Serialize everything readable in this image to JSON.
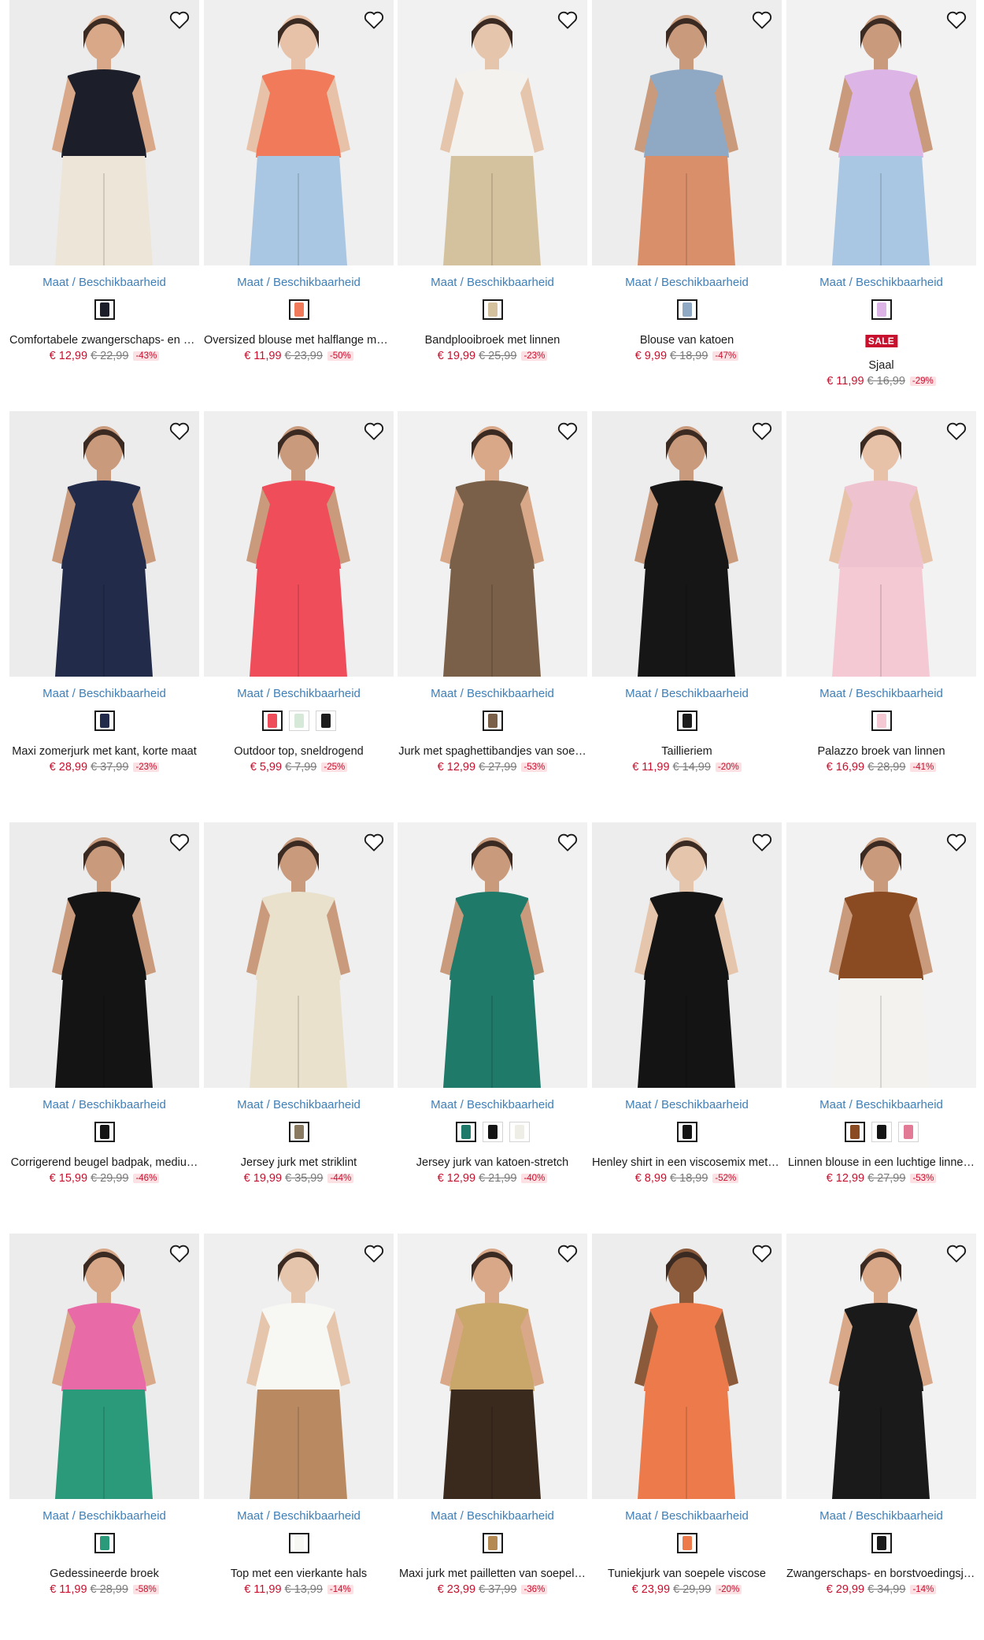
{
  "size_link_label": "Maat / Beschikbaarheid",
  "colors": {
    "accent_price": "#c8102e",
    "link": "#3f7fb8",
    "sale_badge": "#c8102e",
    "discount_bg": "#fbe1e4"
  },
  "products": [
    {
      "title": "Comfortabele zwangerschaps- en b…",
      "price": "€ 12,99",
      "old": "€ 22,99",
      "discount": "-43%",
      "sale": "",
      "bg": "#ececec",
      "swatches": [
        "#1c1f2a"
      ],
      "top": "#1c1f2a",
      "bottom": "#ece5d8",
      "skin": "#d8a888"
    },
    {
      "title": "Oversized blouse met halflange mo…",
      "price": "€ 11,99",
      "old": "€ 23,99",
      "discount": "-50%",
      "sale": "",
      "bg": "#efefef",
      "swatches": [
        "#f07a5a"
      ],
      "top": "#f07a5a",
      "bottom": "#a9c6e2",
      "skin": "#e8c2a8"
    },
    {
      "title": "Bandplooibroek met linnen",
      "price": "€ 19,99",
      "old": "€ 25,99",
      "discount": "-23%",
      "sale": "",
      "bg": "#f1f1f1",
      "swatches": [
        "#d4c29e"
      ],
      "top": "#f4f2ee",
      "bottom": "#d4c29e",
      "skin": "#e5c6ad"
    },
    {
      "title": "Blouse van katoen",
      "price": "€ 9,99",
      "old": "€ 18,99",
      "discount": "-47%",
      "sale": "",
      "bg": "#ededed",
      "swatches": [
        "#8fa8c4"
      ],
      "top": "#8fa8c4",
      "bottom": "#d98f6a",
      "skin": "#c99a7c"
    },
    {
      "title": "Sjaal",
      "price": "€ 11,99",
      "old": "€ 16,99",
      "discount": "-29%",
      "sale": "SALE",
      "bg": "#f2f2f2",
      "swatches": [
        "#dcb4e6"
      ],
      "top": "#dcb4e6",
      "bottom": "#a9c6e2",
      "skin": "#c99a7c"
    },
    {
      "title": "Maxi zomerjurk met kant, korte maat",
      "price": "€ 28,99",
      "old": "€ 37,99",
      "discount": "-23%",
      "sale": "",
      "bg": "#ececec",
      "swatches": [
        "#222b4a"
      ],
      "top": "#222b4a",
      "bottom": "#222b4a",
      "skin": "#c99a7c"
    },
    {
      "title": "Outdoor top, sneldrogend",
      "price": "€ 5,99",
      "old": "€ 7,99",
      "discount": "-25%",
      "sale": "",
      "bg": "#efefef",
      "swatches": [
        "#ef4d5a",
        "#d6e8d8",
        "#1c1c1c"
      ],
      "top": "#ef4d5a",
      "bottom": "#ef4d5a",
      "skin": "#c99a7c"
    },
    {
      "title": "Jurk met spaghettibandjes van soe…",
      "price": "€ 12,99",
      "old": "€ 27,99",
      "discount": "-53%",
      "sale": "",
      "bg": "#f1f1f1",
      "swatches": [
        "#7a6048"
      ],
      "top": "#7a6048",
      "bottom": "#7a6048",
      "skin": "#d8a888"
    },
    {
      "title": "Taillieriem",
      "price": "€ 11,99",
      "old": "€ 14,99",
      "discount": "-20%",
      "sale": "",
      "bg": "#ededed",
      "swatches": [
        "#1c1c1c"
      ],
      "top": "#161616",
      "bottom": "#161616",
      "skin": "#c99a7c"
    },
    {
      "title": "Palazzo broek van linnen",
      "price": "€ 16,99",
      "old": "€ 28,99",
      "discount": "-41%",
      "sale": "",
      "bg": "#f2f2f2",
      "swatches": [
        "#f4c9d4"
      ],
      "top": "#eec2cf",
      "bottom": "#f4c9d4",
      "skin": "#e8c2a8"
    },
    {
      "title": "Corrigerend beugel badpak, mediu…",
      "price": "€ 15,99",
      "old": "€ 29,99",
      "discount": "-46%",
      "sale": "",
      "bg": "#ececec",
      "swatches": [
        "#141414"
      ],
      "top": "#141414",
      "bottom": "#141414",
      "skin": "#c99a7c"
    },
    {
      "title": "Jersey jurk met striklint",
      "price": "€ 19,99",
      "old": "€ 35,99",
      "discount": "-44%",
      "sale": "",
      "bg": "#efefef",
      "swatches": [
        "#8a7a62"
      ],
      "top": "#e9e1cc",
      "bottom": "#e9e1cc",
      "skin": "#c99a7c"
    },
    {
      "title": "Jersey jurk van katoen-stretch",
      "price": "€ 12,99",
      "old": "€ 21,99",
      "discount": "-40%",
      "sale": "",
      "bg": "#f1f1f1",
      "swatches": [
        "#1f7a6a",
        "#141414",
        "#efeee6"
      ],
      "top": "#1f7a6a",
      "bottom": "#1f7a6a",
      "skin": "#c99a7c"
    },
    {
      "title": "Henley shirt in een viscosemix met …",
      "price": "€ 8,99",
      "old": "€ 18,99",
      "discount": "-52%",
      "sale": "",
      "bg": "#ededed",
      "swatches": [
        "#141414"
      ],
      "top": "#141414",
      "bottom": "#141414",
      "skin": "#e5c6ad"
    },
    {
      "title": "Linnen blouse in een luchtige linne…",
      "price": "€ 12,99",
      "old": "€ 27,99",
      "discount": "-53%",
      "sale": "",
      "bg": "#f2f2f2",
      "swatches": [
        "#8a4a22",
        "#141414",
        "#e27a96"
      ],
      "top": "#8a4a22",
      "bottom": "#f4f2ee",
      "skin": "#c99a7c"
    },
    {
      "title": "Gedessineerde broek",
      "price": "€ 11,99",
      "old": "€ 28,99",
      "discount": "-58%",
      "sale": "",
      "bg": "#ececec",
      "swatches": [
        "#2a9a7a"
      ],
      "top": "#e86aa6",
      "bottom": "#2a9a7a",
      "skin": "#d8a888"
    },
    {
      "title": "Top met een vierkante hals",
      "price": "€ 11,99",
      "old": "€ 13,99",
      "discount": "-14%",
      "sale": "",
      "bg": "#efefef",
      "swatches": [
        "#f7f7f4"
      ],
      "top": "#f7f7f4",
      "bottom": "#b98a62",
      "skin": "#e5c6ad"
    },
    {
      "title": "Maxi jurk met pailletten van soepel…",
      "price": "€ 23,99",
      "old": "€ 37,99",
      "discount": "-36%",
      "sale": "",
      "bg": "#f1f1f1",
      "swatches": [
        "#b48a52"
      ],
      "top": "#c9a66a",
      "bottom": "#3a2a1e",
      "skin": "#d8a888"
    },
    {
      "title": "Tuniekjurk van soepele viscose",
      "price": "€ 23,99",
      "old": "€ 29,99",
      "discount": "-20%",
      "sale": "",
      "bg": "#ededed",
      "swatches": [
        "#ec7a4a"
      ],
      "top": "#ec7a4a",
      "bottom": "#ec7a4a",
      "skin": "#8a5a3a"
    },
    {
      "title": "Zwangerschaps- en borstvoedingsju…",
      "price": "€ 29,99",
      "old": "€ 34,99",
      "discount": "-14%",
      "sale": "",
      "bg": "#f2f2f2",
      "swatches": [
        "#1a1a1a"
      ],
      "top": "#1a1a1a",
      "bottom": "#1a1a1a",
      "skin": "#d8a888"
    }
  ]
}
